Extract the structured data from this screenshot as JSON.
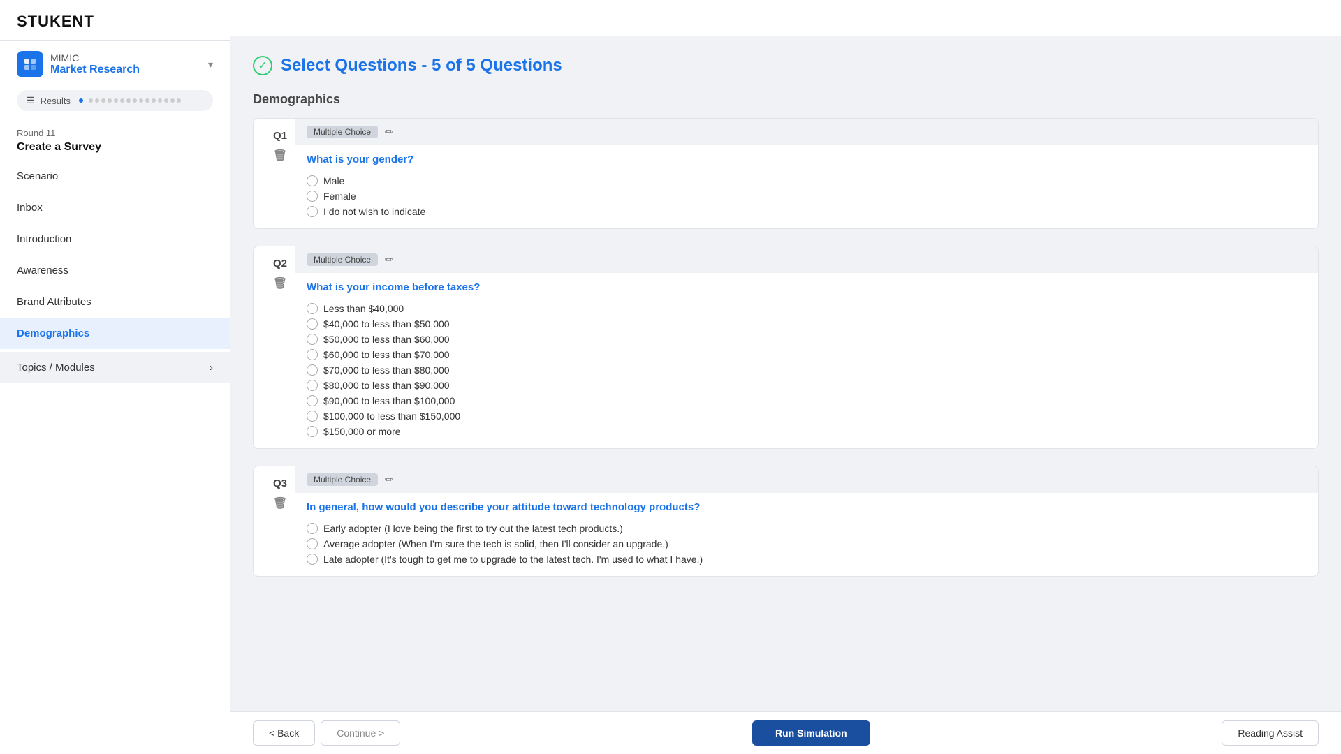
{
  "brand": {
    "logo": "STUKENT",
    "product_label": "MIMIC",
    "product_name": "Market Research",
    "chevron": "▾"
  },
  "results": {
    "label": "Results",
    "dots": [
      true,
      false,
      false,
      false,
      false,
      false,
      false,
      false,
      false,
      false,
      false,
      false,
      false,
      false,
      false,
      false
    ]
  },
  "round": {
    "label": "Round 11",
    "title": "Create a Survey"
  },
  "nav": {
    "items": [
      {
        "id": "scenario",
        "label": "Scenario",
        "active": false
      },
      {
        "id": "inbox",
        "label": "Inbox",
        "active": false
      },
      {
        "id": "introduction",
        "label": "Introduction",
        "active": false
      },
      {
        "id": "awareness",
        "label": "Awareness",
        "active": false
      },
      {
        "id": "brand-attributes",
        "label": "Brand Attributes",
        "active": false
      },
      {
        "id": "demographics",
        "label": "Demographics",
        "active": true
      },
      {
        "id": "topics-modules",
        "label": "Topics / Modules",
        "active": false
      }
    ]
  },
  "page": {
    "title": "Select Questions - 5 of 5 Questions"
  },
  "section": {
    "title": "Demographics"
  },
  "questions": [
    {
      "number": "Q1",
      "type": "Multiple Choice",
      "text": "What is your gender?",
      "options": [
        "Male",
        "Female",
        "I do not wish to indicate"
      ]
    },
    {
      "number": "Q2",
      "type": "Multiple Choice",
      "text": "What is your income before taxes?",
      "options": [
        "Less than $40,000",
        "$40,000 to less than $50,000",
        "$50,000 to less than $60,000",
        "$60,000 to less than $70,000",
        "$70,000 to less than $80,000",
        "$80,000 to less than $90,000",
        "$90,000 to less than $100,000",
        "$100,000 to less than $150,000",
        "$150,000 or more"
      ]
    },
    {
      "number": "Q3",
      "type": "Multiple Choice",
      "text": "In general, how would you describe your attitude toward technology products?",
      "options": [
        "Early adopter (I love being the first to try out the latest tech products.)",
        "Average adopter (When I'm sure the tech is solid, then I'll consider an upgrade.)",
        "Late adopter (It's tough to get me to upgrade to the latest tech. I'm used to what I have.)"
      ]
    }
  ],
  "footer": {
    "back_label": "< Back",
    "continue_label": "Continue >",
    "run_simulation_label": "Run Simulation",
    "reading_assist_label": "Reading Assist"
  }
}
